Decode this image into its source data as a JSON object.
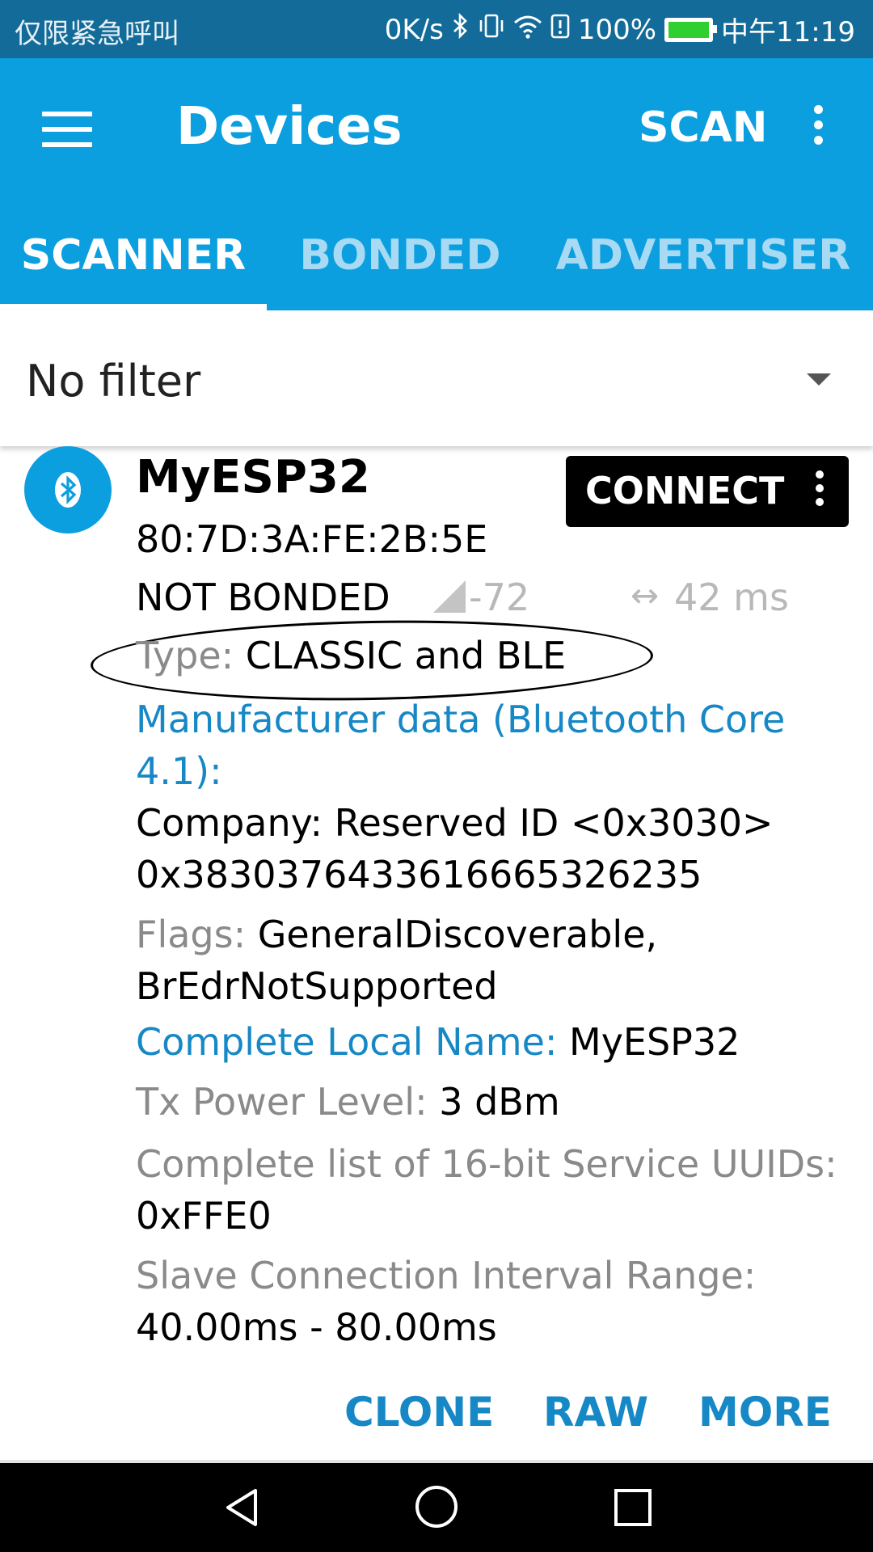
{
  "status_bar": {
    "carrier_text": "仅限紧急呼叫",
    "net_speed": "0K/s",
    "battery": "100%",
    "time": "中午11:19",
    "icons": [
      "bluetooth-icon",
      "vibrate-icon",
      "wifi-icon",
      "alert-icon",
      "battery-icon"
    ]
  },
  "appbar": {
    "title": "Devices",
    "scan_label": "SCAN",
    "tabs": [
      {
        "label": "SCANNER",
        "selected": true
      },
      {
        "label": "BONDED",
        "selected": false
      },
      {
        "label": "ADVERTISER",
        "selected": false
      }
    ]
  },
  "filter": {
    "label": "No filter"
  },
  "device": {
    "name": "MyESP32",
    "mac": "80:7D:3A:FE:2B:5E",
    "bond_state": "NOT BONDED",
    "rssi": "-72",
    "interval": "42 ms",
    "connect_label": "CONNECT",
    "type_label": "Type: ",
    "type_value": "CLASSIC and BLE",
    "manufacturer_label": "Manufacturer data (Bluetooth Core 4.1):",
    "company_line": "Company: Reserved ID <0x3030>",
    "company_data": "0x3830376433616665326235",
    "flags_label": "Flags: ",
    "flags_value": "GeneralDiscoverable, BrEdrNotSupported",
    "local_name_label": "Complete Local Name: ",
    "local_name_value": "MyESP32",
    "tx_power_label": "Tx Power Level: ",
    "tx_power_value": "3 dBm",
    "uuids_label": "Complete list of 16-bit Service UUIDs: ",
    "uuids_value": "0xFFE0",
    "slave_label": "Slave Connection Interval Range: ",
    "slave_value": "40.00ms - 80.00ms",
    "actions": {
      "clone": "CLONE",
      "raw": "RAW",
      "more": "MORE"
    }
  },
  "colors": {
    "status_bar": "#136b99",
    "app_bar": "#0c9fdf",
    "accent_blue": "#1688c6",
    "secondary_text": "#8a8a8a"
  }
}
